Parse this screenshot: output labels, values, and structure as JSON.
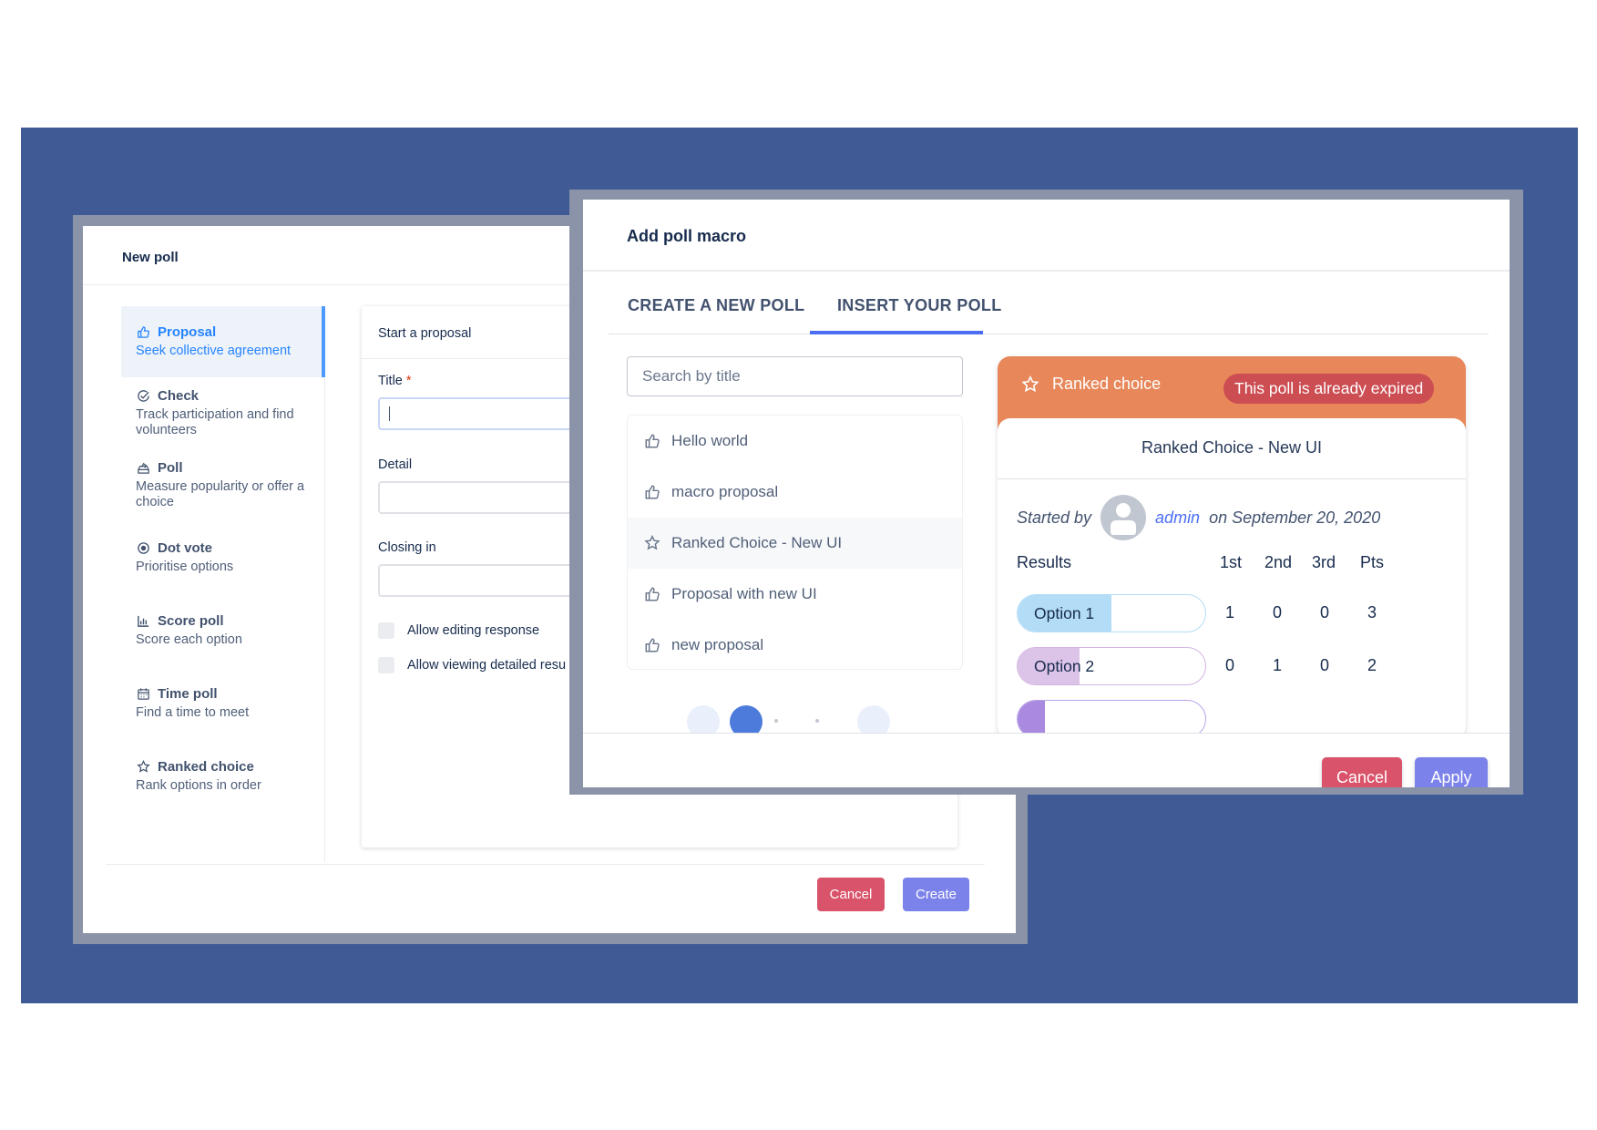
{
  "colors": {
    "stage_bg": "#3f5a95",
    "accent": "#2684ff",
    "danger": "#d9536a",
    "primary": "#7b83eb",
    "card_header": "#e8875a",
    "badge": "#cc4d52"
  },
  "new_poll": {
    "title": "New poll",
    "types": [
      {
        "icon": "thumbs-up-icon",
        "name": "Proposal",
        "desc": "Seek collective agreement",
        "active": true
      },
      {
        "icon": "check-circle-icon",
        "name": "Check",
        "desc": "Track participation and find volunteers"
      },
      {
        "icon": "ballot-box-icon",
        "name": "Poll",
        "desc": "Measure popularity or offer a choice"
      },
      {
        "icon": "target-dot-icon",
        "name": "Dot vote",
        "desc": "Prioritise options"
      },
      {
        "icon": "bar-chart-icon",
        "name": "Score poll",
        "desc": "Score each option"
      },
      {
        "icon": "calendar-icon",
        "name": "Time poll",
        "desc": "Find a time to meet"
      },
      {
        "icon": "star-icon",
        "name": "Ranked choice",
        "desc": "Rank options in order"
      }
    ],
    "form": {
      "heading": "Start a proposal",
      "title_label": "Title",
      "required_mark": "*",
      "detail_label": "Detail",
      "closing_label": "Closing in",
      "options": [
        "Allow editing response",
        "Allow viewing detailed resu"
      ]
    },
    "cancel_label": "Cancel",
    "create_label": "Create"
  },
  "macro": {
    "title": "Add poll macro",
    "tabs": [
      {
        "label": "CREATE A NEW POLL",
        "active": false
      },
      {
        "label": "INSERT YOUR POLL",
        "active": true
      }
    ],
    "search_placeholder": "Search by title",
    "polls": [
      {
        "icon": "thumbs-up-icon",
        "title": "Hello world"
      },
      {
        "icon": "thumbs-up-icon",
        "title": "macro proposal"
      },
      {
        "icon": "star-icon",
        "title": "Ranked Choice - New UI",
        "highlighted": true
      },
      {
        "icon": "thumbs-up-icon",
        "title": "Proposal with new UI"
      },
      {
        "icon": "thumbs-up-icon",
        "title": "new proposal"
      }
    ],
    "preview": {
      "type_label": "Ranked choice",
      "badge": "This poll is already expired",
      "title": "Ranked Choice - New UI",
      "started_by": "Started by",
      "author": "admin",
      "date": "on September 20, 2020",
      "results_label": "Results",
      "columns": [
        "1st",
        "2nd",
        "3rd",
        "Pts"
      ],
      "rows": [
        {
          "option": "Option 1",
          "share": 0.5,
          "values": [
            1,
            0,
            0,
            3
          ],
          "fill": "#b3dcf7",
          "border": "#b3dcf7"
        },
        {
          "option": "Option 2",
          "share": 0.33,
          "values": [
            0,
            1,
            0,
            2
          ],
          "fill": "#dcc3e8",
          "border": "#d3b4e3"
        }
      ]
    },
    "cancel_label": "Cancel",
    "apply_label": "Apply"
  }
}
